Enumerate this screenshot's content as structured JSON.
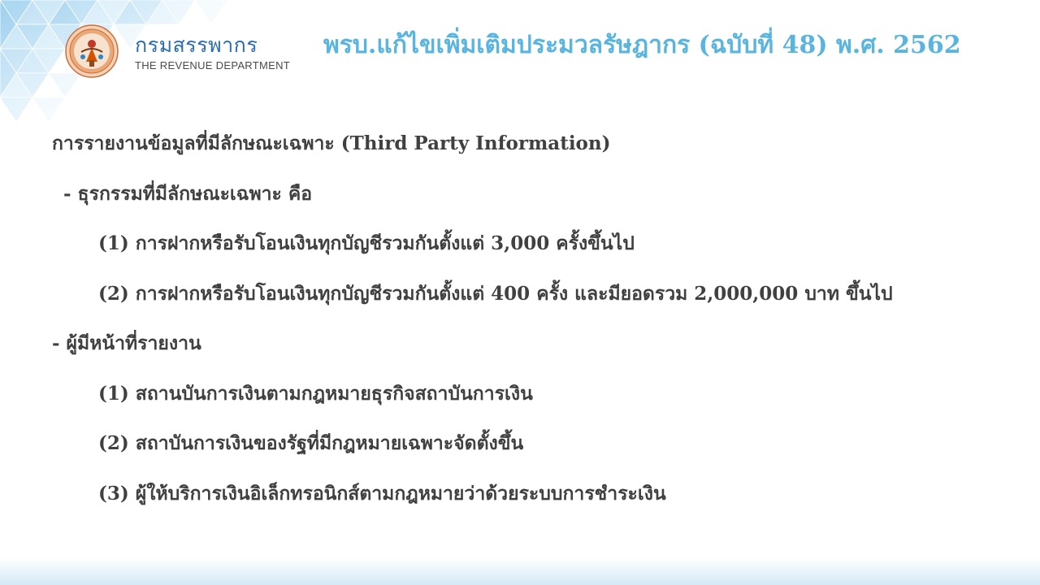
{
  "header": {
    "dept_name_th": "กรมสรรพากร",
    "dept_name_en": "THE REVENUE DEPARTMENT",
    "logo_icon": "revenue-department-seal-icon",
    "title": "พรบ.แก้ไขเพิ่มเติมประมวลรัษฎากร (ฉบับที่ 48) พ.ศ. 2562"
  },
  "content": {
    "heading": "การรายงานข้อมูลที่มีลักษณะเฉพาะ (Third Party Information)",
    "transactions": {
      "label": "- ธุรกรรมที่มีลักษณะเฉพาะ คือ",
      "items": [
        "(1) การฝากหรือรับโอนเงินทุกบัญชีรวมกันตั้งแต่ 3,000 ครั้งขึ้นไป",
        "(2) การฝากหรือรับโอนเงินทุกบัญชีรวมกันตั้งแต่ 400 ครั้ง และมียอดรวม 2,000,000 บาท ขึ้นไป"
      ]
    },
    "reporters": {
      "label": "- ผู้มีหน้าที่รายงาน",
      "items": [
        "(1) สถานบันการเงินตามกฎหมายธุรกิจสถาบันการเงิน",
        "(2) สถาบันการเงินของรัฐที่มีกฎหมายเฉพาะจัดตั้งขึ้น",
        "(3) ผู้ให้บริการเงินอิเล็กทรอนิกส์ตามกฎหมายว่าด้วยระบบการชำระเงิน"
      ]
    }
  },
  "colors": {
    "title": "#59b5e0",
    "body_text": "#404040",
    "dept_name": "#2b6db3",
    "accent_triangles": "#bfe0f4"
  }
}
